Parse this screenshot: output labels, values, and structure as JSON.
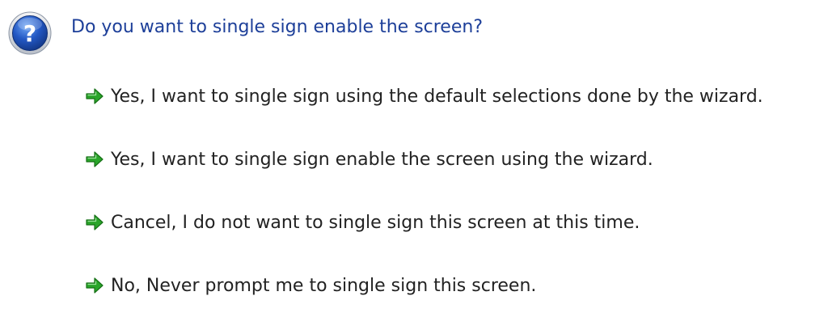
{
  "question": {
    "icon": "question-icon",
    "text": "Do you want to single sign enable the screen?"
  },
  "options": [
    {
      "icon": "green-arrow-icon",
      "label": "Yes, I want to single sign using the default selections done by the wizard."
    },
    {
      "icon": "green-arrow-icon",
      "label": "Yes, I want to single sign enable the screen using the wizard."
    },
    {
      "icon": "green-arrow-icon",
      "label": "Cancel, I do not want to single sign this screen at this time."
    },
    {
      "icon": "green-arrow-icon",
      "label": "No, Never prompt me to single sign this screen."
    }
  ],
  "colors": {
    "question_text": "#1d3f99",
    "option_text": "#222222",
    "arrow_green": "#2aa52a",
    "icon_blue": "#1f4fb8"
  }
}
